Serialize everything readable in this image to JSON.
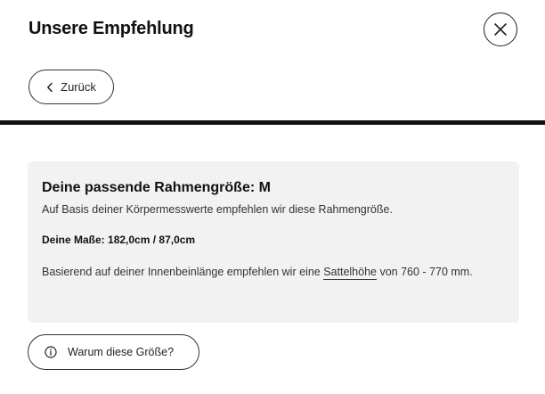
{
  "header": {
    "title": "Unsere Empfehlung",
    "close_icon": "close-icon",
    "back_label": "Zurück",
    "back_icon": "chevron-left-icon"
  },
  "card": {
    "title": "Deine passende Rahmengröße: M",
    "subtitle": "Auf Basis deiner Körpermesswerte empfehlen wir diese Rahmengröße.",
    "measures": "Deine Maße: 182,0cm / 87,0cm",
    "recommendation_before": "Basierend auf deiner Innenbeinlänge empfehlen wir eine ",
    "recommendation_link": "Sattelhöhe",
    "recommendation_after": " von 760 - 770 mm."
  },
  "why_button": {
    "label": "Warum diese Größe?",
    "icon": "info-icon"
  },
  "colors": {
    "card_background": "#f2f2f2",
    "divider": "#111111",
    "text": "#1a1a1a"
  }
}
